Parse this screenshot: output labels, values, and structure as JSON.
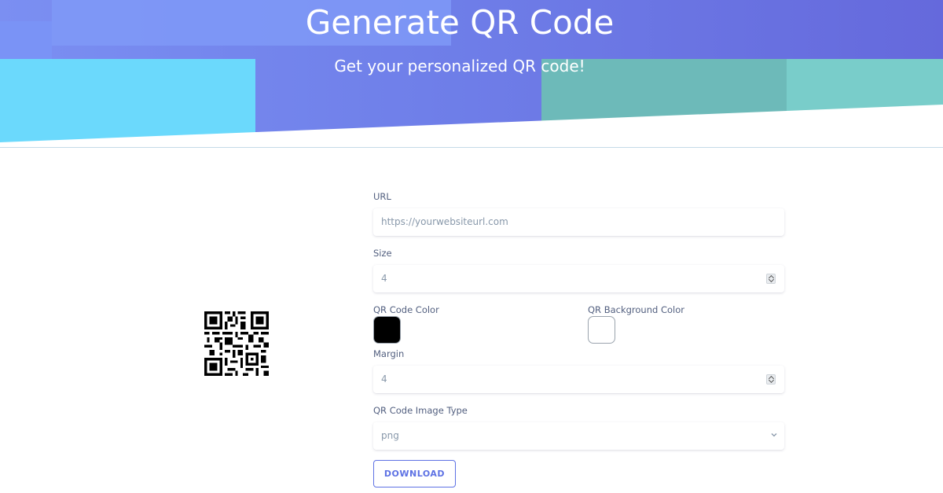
{
  "header": {
    "title": "Generate QR Code",
    "subtitle": "Get your personalized QR code!"
  },
  "form": {
    "url": {
      "label": "URL",
      "placeholder": "https://yourwebsiteurl.com"
    },
    "size": {
      "label": "Size",
      "value": "4"
    },
    "qr_color": {
      "label": "QR Code Color",
      "value": "#000000"
    },
    "bg_color": {
      "label": "QR Background Color",
      "value": "#ffffff"
    },
    "margin": {
      "label": "Margin",
      "value": "4"
    },
    "image_type": {
      "label": "QR Code Image Type",
      "value": "png"
    },
    "download_label": "DOWNLOAD"
  },
  "colors": {
    "accent": "#5e72e4",
    "label_text": "#525f7f",
    "placeholder_text": "#8898aa"
  },
  "icons": {
    "spinner": "number-stepper-icon",
    "select_arrow": "chevron-down-icon"
  }
}
